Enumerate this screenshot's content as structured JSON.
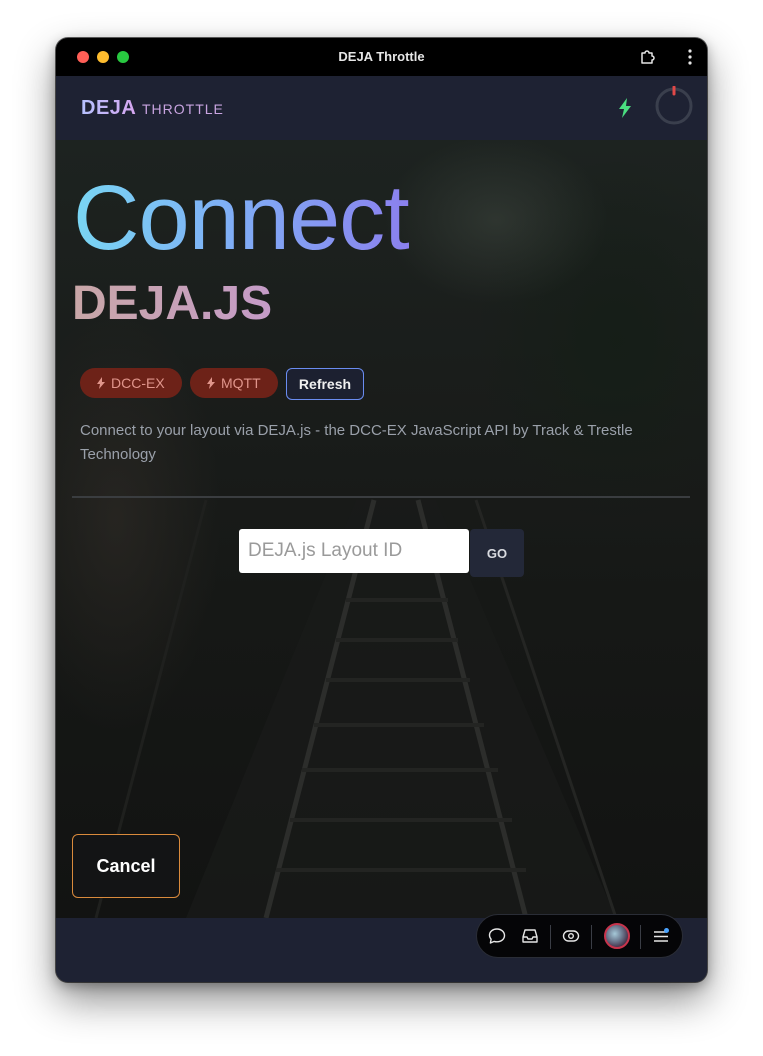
{
  "window": {
    "title": "DEJA Throttle"
  },
  "header": {
    "brand": "DEJA",
    "brand_sub": "THROTTLE"
  },
  "hero": {
    "title": "Connect",
    "subtitle": "DEJA.JS"
  },
  "chips": [
    {
      "label": "DCC-EX",
      "icon": "bolt-icon"
    },
    {
      "label": "MQTT",
      "icon": "bolt-icon"
    }
  ],
  "refresh_label": "Refresh",
  "description": "Connect to your layout via DEJA.js - the DCC-EX JavaScript API by Track & Trestle Technology",
  "layout_input": {
    "placeholder": "DEJA.js Layout ID",
    "value": ""
  },
  "go_label": "GO",
  "cancel_label": "Cancel",
  "dock": {
    "items": [
      "chat-icon",
      "inbox-icon",
      "eye-icon",
      "avatar",
      "menu-icon"
    ]
  },
  "colors": {
    "accent_blue": "#79d6f3",
    "accent_purple": "#8b80ee",
    "chip_bg": "#6d2218",
    "connected_green": "#4ade80",
    "cancel_border": "#d98a3c"
  }
}
